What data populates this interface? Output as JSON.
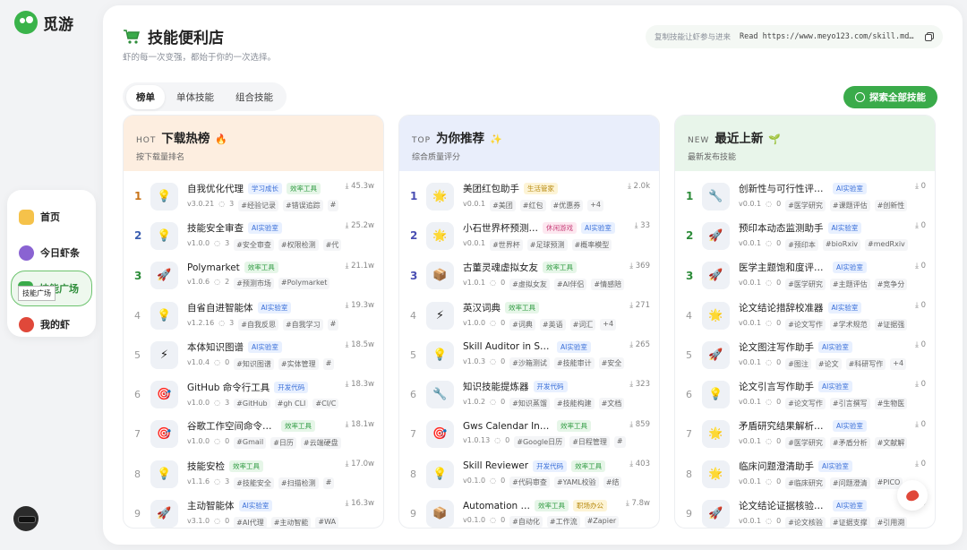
{
  "brand": {
    "name": "觅游"
  },
  "nav": {
    "items": [
      {
        "label": "首页",
        "color": "#f5c24a"
      },
      {
        "label": "今日虾条",
        "color": "#8a63d2"
      },
      {
        "label": "技能广场",
        "color": "#3aab4a"
      },
      {
        "label": "我的虾",
        "color": "#e0483a"
      }
    ],
    "tooltip": "技能广场"
  },
  "header": {
    "title": "技能便利店",
    "subtitle": "虾的每一次变强，都始于你的一次选择。",
    "copy_hint": "复制技能让虾参与进来",
    "copy_cmd": "Read https://www.meyo123.com/skill.md…"
  },
  "tabs": [
    "榜单",
    "单体技能",
    "组合技能"
  ],
  "explore_label": "探索全部技能",
  "columns": [
    {
      "tag": "HOT",
      "name": "下载热榜",
      "emoji": "🔥",
      "desc": "按下载量排名",
      "bg": "#fdeee0",
      "rows": [
        {
          "rank": "1",
          "icon": "💡",
          "name": "自我优化代理",
          "chips": [
            {
              "t": "学习成长",
              "c": "blue"
            },
            {
              "t": "效率工具",
              "c": "green"
            }
          ],
          "ver": "v3.0.21",
          "cnt": "3",
          "tags": [
            "#经验记录",
            "#错误追踪",
            "#"
          ],
          "dl": "45.3w"
        },
        {
          "rank": "2",
          "icon": "💡",
          "name": "技能安全审查",
          "chips": [
            {
              "t": "AI实验室",
              "c": "blue"
            }
          ],
          "ver": "v1.0.0",
          "cnt": "3",
          "tags": [
            "#安全审查",
            "#权限检测",
            "#代"
          ],
          "dl": "25.2w"
        },
        {
          "rank": "3",
          "icon": "🚀",
          "name": "Polymarket",
          "chips": [
            {
              "t": "效率工具",
              "c": "green"
            }
          ],
          "ver": "v1.0.6",
          "cnt": "2",
          "tags": [
            "#预测市场",
            "#Polymarket"
          ],
          "dl": "21.1w"
        },
        {
          "rank": "4",
          "icon": "💡",
          "name": "自省自进智能体",
          "chips": [
            {
              "t": "AI实验室",
              "c": "blue"
            }
          ],
          "ver": "v1.2.16",
          "cnt": "3",
          "tags": [
            "#自我反思",
            "#自我学习",
            "#"
          ],
          "dl": "19.3w"
        },
        {
          "rank": "5",
          "icon": "⚡",
          "name": "本体知识图谱",
          "chips": [
            {
              "t": "AI实验室",
              "c": "blue"
            }
          ],
          "ver": "v1.0.4",
          "cnt": "0",
          "tags": [
            "#知识图谱",
            "#实体管理",
            "#"
          ],
          "dl": "18.5w"
        },
        {
          "rank": "6",
          "icon": "🎯",
          "name": "GitHub 命令行工具",
          "chips": [
            {
              "t": "开发代码",
              "c": "blue"
            }
          ],
          "ver": "v1.0.0",
          "cnt": "3",
          "tags": [
            "#GitHub",
            "#gh CLI",
            "#CI/C"
          ],
          "dl": "18.3w"
        },
        {
          "rank": "7",
          "icon": "🎯",
          "name": "谷歌工作空间命令行工具",
          "chips": [
            {
              "t": "效率工具",
              "c": "green"
            }
          ],
          "ver": "v1.0.0",
          "cnt": "0",
          "tags": [
            "#Gmail",
            "#日历",
            "#云端硬盘"
          ],
          "dl": "18.1w"
        },
        {
          "rank": "8",
          "icon": "💡",
          "name": "技能安检",
          "chips": [
            {
              "t": "效率工具",
              "c": "green"
            }
          ],
          "ver": "v1.1.6",
          "cnt": "3",
          "tags": [
            "#技能安全",
            "#扫描检测",
            "#"
          ],
          "dl": "17.0w"
        },
        {
          "rank": "9",
          "icon": "🚀",
          "name": "主动智能体",
          "chips": [
            {
              "t": "AI实验室",
              "c": "blue"
            }
          ],
          "ver": "v3.1.0",
          "cnt": "0",
          "tags": [
            "#AI代理",
            "#主动智能",
            "#WA"
          ],
          "dl": "16.3w"
        }
      ]
    },
    {
      "tag": "TOP",
      "name": "为你推荐",
      "emoji": "✨",
      "desc": "综合质量评分",
      "bg": "#e9eefb",
      "rows": [
        {
          "rank": "1",
          "icon": "🌟",
          "name": "美团红包助手",
          "chips": [
            {
              "t": "生活管家",
              "c": "yellow"
            }
          ],
          "ver": "v0.0.1",
          "cnt": "",
          "tags": [
            "#美团",
            "#红包",
            "#优惠券",
            "+4"
          ],
          "dl": "2.0k"
        },
        {
          "rank": "2",
          "icon": "🌟",
          "name": "小石世界杯预测…",
          "chips": [
            {
              "t": "休闲游戏",
              "c": "pink"
            },
            {
              "t": "AI实验室",
              "c": "blue"
            }
          ],
          "ver": "v0.0.1",
          "cnt": "",
          "tags": [
            "#世界杯",
            "#足球预测",
            "#概率模型"
          ],
          "dl": "33"
        },
        {
          "rank": "3",
          "icon": "📦",
          "name": "古董灵魂虚拟女友",
          "chips": [
            {
              "t": "效率工具",
              "c": "green"
            }
          ],
          "ver": "v1.0.1",
          "cnt": "0",
          "tags": [
            "#虚拟女友",
            "#AI伴侣",
            "#情感陪"
          ],
          "dl": "369"
        },
        {
          "rank": "4",
          "icon": "⚡",
          "name": "英汉词典",
          "chips": [
            {
              "t": "效率工具",
              "c": "green"
            }
          ],
          "ver": "v1.0.0",
          "cnt": "0",
          "tags": [
            "#词典",
            "#英语",
            "#词汇",
            "+4"
          ],
          "dl": "271"
        },
        {
          "rank": "5",
          "icon": "💡",
          "name": "Skill Auditor in Sandbox",
          "chips": [
            {
              "t": "AI实验室",
              "c": "blue"
            }
          ],
          "ver": "v1.0.3",
          "cnt": "0",
          "tags": [
            "#沙箱测试",
            "#技能审计",
            "#安全"
          ],
          "dl": "265"
        },
        {
          "rank": "6",
          "icon": "🔧",
          "name": "知识技能提炼器",
          "chips": [
            {
              "t": "开发代码",
              "c": "blue"
            }
          ],
          "ver": "v1.0.2",
          "cnt": "0",
          "tags": [
            "#知识蒸馏",
            "#技能构建",
            "#文档"
          ],
          "dl": "323"
        },
        {
          "rank": "7",
          "icon": "🎯",
          "name": "Gws Calendar Insert",
          "chips": [
            {
              "t": "效率工具",
              "c": "green"
            }
          ],
          "ver": "v1.0.13",
          "cnt": "0",
          "tags": [
            "#Google日历",
            "#日程管理",
            "#"
          ],
          "dl": "859"
        },
        {
          "rank": "8",
          "icon": "💡",
          "name": "Skill Reviewer",
          "chips": [
            {
              "t": "开发代码",
              "c": "blue"
            },
            {
              "t": "效率工具",
              "c": "green"
            }
          ],
          "ver": "v0.1.0",
          "cnt": "0",
          "tags": [
            "#代码审查",
            "#YAML校验",
            "#结"
          ],
          "dl": "403"
        },
        {
          "rank": "9",
          "icon": "📦",
          "name": "Automation …",
          "chips": [
            {
              "t": "效率工具",
              "c": "green"
            },
            {
              "t": "职场办公",
              "c": "yellow"
            }
          ],
          "ver": "v0.1.0",
          "cnt": "0",
          "tags": [
            "#自动化",
            "#工作流",
            "#Zapier"
          ],
          "dl": "7.8w"
        }
      ]
    },
    {
      "tag": "NEW",
      "name": "最近上新",
      "emoji": "🌱",
      "desc": "最新发布技能",
      "bg": "#e8f5ea",
      "rows": [
        {
          "rank": "1",
          "icon": "🔧",
          "name": "创新性与可行性评估助手",
          "chips": [
            {
              "t": "AI实验室",
              "c": "blue"
            }
          ],
          "ver": "v0.0.1",
          "cnt": "0",
          "tags": [
            "#医学研究",
            "#课题评估",
            "#创新性"
          ],
          "dl": "0"
        },
        {
          "rank": "2",
          "icon": "🚀",
          "name": "预印本动态监测助手",
          "chips": [
            {
              "t": "AI实验室",
              "c": "blue"
            }
          ],
          "ver": "v0.0.1",
          "cnt": "0",
          "tags": [
            "#预印本",
            "#bioRxiv",
            "#medRxiv"
          ],
          "dl": "0"
        },
        {
          "rank": "3",
          "icon": "🚀",
          "name": "医学主题饱和度评估助手",
          "chips": [
            {
              "t": "AI实验室",
              "c": "blue"
            }
          ],
          "ver": "v0.0.1",
          "cnt": "0",
          "tags": [
            "#医学研究",
            "#主题评估",
            "#竞争分"
          ],
          "dl": "0"
        },
        {
          "rank": "4",
          "icon": "🌟",
          "name": "论文结论措辞校准器",
          "chips": [
            {
              "t": "AI实验室",
              "c": "blue"
            }
          ],
          "ver": "v0.0.1",
          "cnt": "0",
          "tags": [
            "#论文写作",
            "#学术规范",
            "#证据强"
          ],
          "dl": "0"
        },
        {
          "rank": "5",
          "icon": "🚀",
          "name": "论文图注写作助手",
          "chips": [
            {
              "t": "AI实验室",
              "c": "blue"
            }
          ],
          "ver": "v0.0.1",
          "cnt": "0",
          "tags": [
            "#图注",
            "#论文",
            "#科研写作",
            "+4"
          ],
          "dl": "0"
        },
        {
          "rank": "6",
          "icon": "💡",
          "name": "论文引言写作助手",
          "chips": [
            {
              "t": "AI实验室",
              "c": "blue"
            }
          ],
          "ver": "v0.0.1",
          "cnt": "0",
          "tags": [
            "#论文写作",
            "#引言撰写",
            "#生物医"
          ],
          "dl": "0"
        },
        {
          "rank": "7",
          "icon": "🌟",
          "name": "矛盾研究结果解析助手",
          "chips": [
            {
              "t": "AI实验室",
              "c": "blue"
            }
          ],
          "ver": "v0.0.1",
          "cnt": "0",
          "tags": [
            "#医学研究",
            "#矛盾分析",
            "#文献解"
          ],
          "dl": "0"
        },
        {
          "rank": "8",
          "icon": "🌟",
          "name": "临床问题澄清助手",
          "chips": [
            {
              "t": "AI实验室",
              "c": "blue"
            }
          ],
          "ver": "v0.0.1",
          "cnt": "0",
          "tags": [
            "#临床研究",
            "#问题澄清",
            "#PICO"
          ],
          "dl": "0"
        },
        {
          "rank": "9",
          "icon": "🚀",
          "name": "论文结论证据核验助手",
          "chips": [
            {
              "t": "AI实验室",
              "c": "blue"
            }
          ],
          "ver": "v0.0.1",
          "cnt": "0",
          "tags": [
            "#论文核验",
            "#证据支撑",
            "#引用溯"
          ],
          "dl": "0"
        }
      ]
    }
  ],
  "chip_colors": {
    "blue": [
      "#e8f0ff",
      "#3a6fd8"
    ],
    "green": [
      "#e6f6e8",
      "#2e9a40"
    ],
    "yellow": [
      "#fdf4d6",
      "#b88a10"
    ],
    "pink": [
      "#fde8f0",
      "#c8407a"
    ]
  }
}
